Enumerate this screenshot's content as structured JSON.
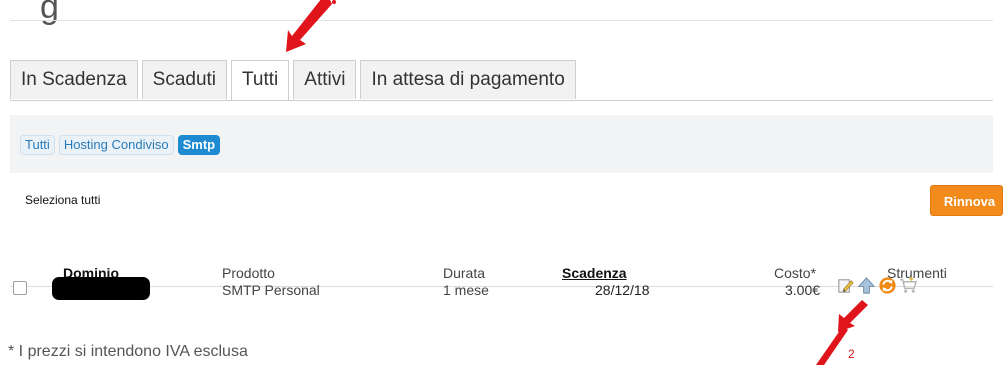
{
  "header": {
    "title_fragment": "g"
  },
  "tabs": [
    {
      "label": "In Scadenza",
      "active": false
    },
    {
      "label": "Scaduti",
      "active": false
    },
    {
      "label": "Tutti",
      "active": true
    },
    {
      "label": "Attivi",
      "active": false
    },
    {
      "label": "In attesa di pagamento",
      "active": false
    }
  ],
  "filters": [
    {
      "label": "Tutti",
      "active": false
    },
    {
      "label": "Hosting Condiviso",
      "active": false
    },
    {
      "label": "Smtp",
      "active": true
    }
  ],
  "actions": {
    "select_all": "Seleziona tutti",
    "renew": "Rinnova"
  },
  "table": {
    "headers": {
      "domain": "Dominio",
      "product": "Prodotto",
      "duration": "Durata",
      "expiry": "Scadenza",
      "cost": "Costo*",
      "tools": "Strumenti"
    },
    "rows": [
      {
        "domain": "",
        "product": "SMTP Personal",
        "duration": "1 mese",
        "expiry": "28/12/18",
        "cost": "3.00€"
      }
    ],
    "tool_icons": [
      "edit-icon",
      "upgrade-icon",
      "renew-icon",
      "cart-icon"
    ]
  },
  "footnote": "* I prezzi si intendono IVA esclusa",
  "annotation": {
    "label": "2",
    "color": "#e0141b"
  },
  "colors": {
    "accent": "#1d8ad2",
    "renew_button": "#f28a1c"
  }
}
